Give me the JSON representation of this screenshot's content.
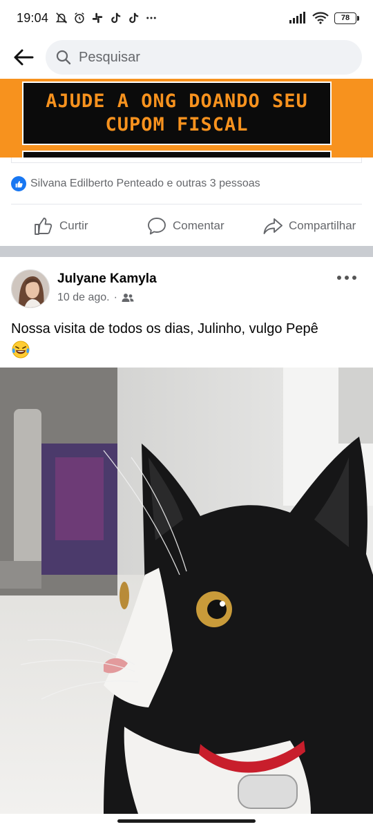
{
  "status_bar": {
    "time": "19:04",
    "battery": "78",
    "left_icons": [
      "mute-alarm-icon",
      "alarm-clock-icon",
      "slack-icon",
      "tiktok-icon",
      "tiktok-icon",
      "more-notifications-icon"
    ],
    "right_icons": [
      "signal-icon",
      "wifi-icon",
      "battery-icon"
    ]
  },
  "search": {
    "placeholder": "Pesquisar"
  },
  "previous_post": {
    "banner_line_1": "AJUDE A ONG DOANDO SEU",
    "banner_line_2": "CUPOM FISCAL",
    "banner_bg": "#f7921e",
    "reactions_text": "Silvana Edilberto Penteado e outras 3 pessoas",
    "actions": {
      "like": "Curtir",
      "comment": "Comentar",
      "share": "Compartilhar"
    }
  },
  "post": {
    "author": "Julyane Kamyla",
    "date": "10 de ago.",
    "audience_icon": "friends-icon",
    "separator": "·",
    "text": "Nossa visita de todos os dias, Julinho, vulgo Pepê",
    "emoji": "😂",
    "photo_description_icon": "cat-photo"
  },
  "colors": {
    "accent": "#1877f2",
    "secondary_text": "#65676b",
    "orange": "#f7921e"
  }
}
